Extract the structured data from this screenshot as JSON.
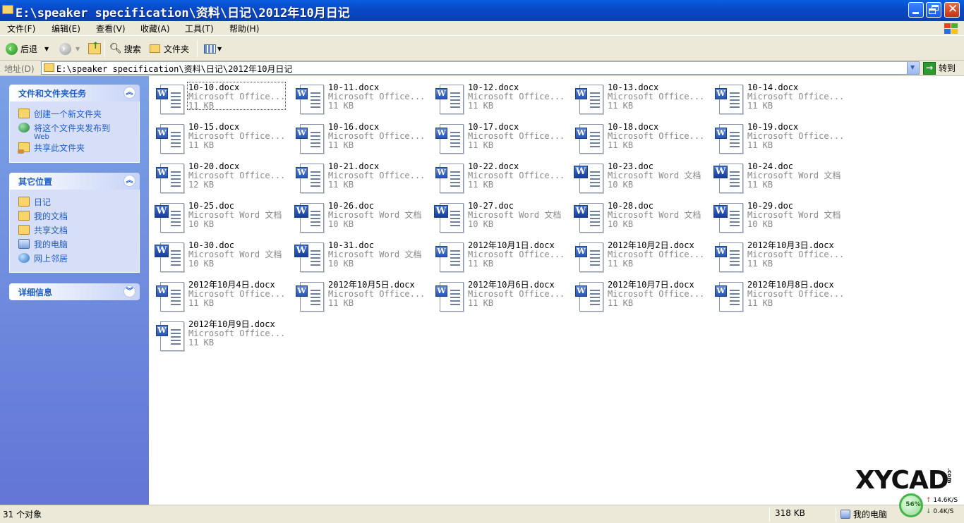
{
  "window": {
    "title": "E:\\speaker specification\\资料\\日记\\2012年10月日记"
  },
  "menu": [
    "文件(F)",
    "编辑(E)",
    "查看(V)",
    "收藏(A)",
    "工具(T)",
    "帮助(H)"
  ],
  "toolbar": {
    "back": "后退",
    "search": "搜索",
    "folders": "文件夹"
  },
  "address": {
    "label": "地址(D)",
    "value": "E:\\speaker specification\\资料\\日记\\2012年10月日记",
    "go": "转到"
  },
  "tasks": {
    "title": "文件和文件夹任务",
    "items": [
      {
        "label": "创建一个新文件夹",
        "icon": "new-folder-icon"
      },
      {
        "label": "将这个文件夹发布到",
        "sub": "Web",
        "icon": "publish-web-icon"
      },
      {
        "label": "共享此文件夹",
        "icon": "share-folder-icon"
      }
    ]
  },
  "places": {
    "title": "其它位置",
    "items": [
      {
        "label": "日记",
        "icon": "folder-icon"
      },
      {
        "label": "我的文档",
        "icon": "my-documents-icon"
      },
      {
        "label": "共享文档",
        "icon": "shared-documents-icon"
      },
      {
        "label": "我的电脑",
        "icon": "my-computer-icon"
      },
      {
        "label": "网上邻居",
        "icon": "network-places-icon"
      }
    ]
  },
  "details": {
    "title": "详细信息"
  },
  "files": [
    {
      "name": "10-10.docx",
      "type": "Microsoft Office...",
      "size": "11 KB",
      "kind": "docx"
    },
    {
      "name": "10-11.docx",
      "type": "Microsoft Office...",
      "size": "11 KB",
      "kind": "docx"
    },
    {
      "name": "10-12.docx",
      "type": "Microsoft Office...",
      "size": "11 KB",
      "kind": "docx"
    },
    {
      "name": "10-13.docx",
      "type": "Microsoft Office...",
      "size": "11 KB",
      "kind": "docx"
    },
    {
      "name": "10-14.docx",
      "type": "Microsoft Office...",
      "size": "11 KB",
      "kind": "docx"
    },
    {
      "name": "10-15.docx",
      "type": "Microsoft Office...",
      "size": "11 KB",
      "kind": "docx"
    },
    {
      "name": "10-16.docx",
      "type": "Microsoft Office...",
      "size": "11 KB",
      "kind": "docx"
    },
    {
      "name": "10-17.docx",
      "type": "Microsoft Office...",
      "size": "11 KB",
      "kind": "docx"
    },
    {
      "name": "10-18.docx",
      "type": "Microsoft Office...",
      "size": "11 KB",
      "kind": "docx"
    },
    {
      "name": "10-19.docx",
      "type": "Microsoft Office...",
      "size": "11 KB",
      "kind": "docx"
    },
    {
      "name": "10-20.docx",
      "type": "Microsoft Office...",
      "size": "12 KB",
      "kind": "docx"
    },
    {
      "name": "10-21.docx",
      "type": "Microsoft Office...",
      "size": "11 KB",
      "kind": "docx"
    },
    {
      "name": "10-22.docx",
      "type": "Microsoft Office...",
      "size": "11 KB",
      "kind": "docx"
    },
    {
      "name": "10-23.doc",
      "type": "Microsoft Word 文档",
      "size": "10 KB",
      "kind": "doc"
    },
    {
      "name": "10-24.doc",
      "type": "Microsoft Word 文档",
      "size": "11 KB",
      "kind": "doc"
    },
    {
      "name": "10-25.doc",
      "type": "Microsoft Word 文档",
      "size": "10 KB",
      "kind": "doc"
    },
    {
      "name": "10-26.doc",
      "type": "Microsoft Word 文档",
      "size": "10 KB",
      "kind": "doc"
    },
    {
      "name": "10-27.doc",
      "type": "Microsoft Word 文档",
      "size": "10 KB",
      "kind": "doc"
    },
    {
      "name": "10-28.doc",
      "type": "Microsoft Word 文档",
      "size": "10 KB",
      "kind": "doc"
    },
    {
      "name": "10-29.doc",
      "type": "Microsoft Word 文档",
      "size": "10 KB",
      "kind": "doc"
    },
    {
      "name": "10-30.doc",
      "type": "Microsoft Word 文档",
      "size": "10 KB",
      "kind": "doc"
    },
    {
      "name": "10-31.doc",
      "type": "Microsoft Word 文档",
      "size": "10 KB",
      "kind": "doc"
    },
    {
      "name": "2012年10月1日.docx",
      "type": "Microsoft Office...",
      "size": "11 KB",
      "kind": "docx"
    },
    {
      "name": "2012年10月2日.docx",
      "type": "Microsoft Office...",
      "size": "11 KB",
      "kind": "docx"
    },
    {
      "name": "2012年10月3日.docx",
      "type": "Microsoft Office...",
      "size": "11 KB",
      "kind": "docx"
    },
    {
      "name": "2012年10月4日.docx",
      "type": "Microsoft Office...",
      "size": "11 KB",
      "kind": "docx"
    },
    {
      "name": "2012年10月5日.docx",
      "type": "Microsoft Office...",
      "size": "11 KB",
      "kind": "docx"
    },
    {
      "name": "2012年10月6日.docx",
      "type": "Microsoft Office...",
      "size": "11 KB",
      "kind": "docx"
    },
    {
      "name": "2012年10月7日.docx",
      "type": "Microsoft Office...",
      "size": "11 KB",
      "kind": "docx"
    },
    {
      "name": "2012年10月8日.docx",
      "type": "Microsoft Office...",
      "size": "11 KB",
      "kind": "docx"
    },
    {
      "name": "2012年10月9日.docx",
      "type": "Microsoft Office...",
      "size": "11 KB",
      "kind": "docx"
    }
  ],
  "watermark": {
    "text": "XYCAD",
    "suffix": ".com"
  },
  "status": {
    "count": "31 个对象",
    "size": "318 KB",
    "location": "我的电脑"
  },
  "net": {
    "percent": "56%",
    "up": "14.6K/S",
    "down": "0.4K/S"
  },
  "colors": {
    "title_bar": "#0848c6",
    "task_pane": "#6375d6",
    "link": "#215dc6"
  }
}
